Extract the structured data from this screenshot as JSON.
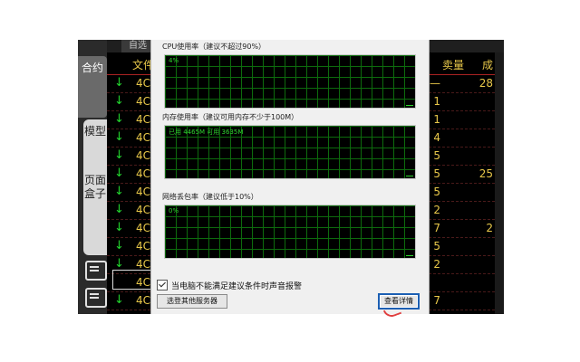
{
  "background_app": {
    "top_tab": "自选",
    "left_tabs": [
      "合约",
      "模型",
      "页面盒子"
    ],
    "headers": {
      "col1": "文件",
      "col_qty": "卖量",
      "col_last": "成"
    },
    "rows": [
      {
        "dir": "↓",
        "code": "4C",
        "qty": "—",
        "qty2": "28"
      },
      {
        "dir": "↓",
        "code": "4C",
        "qty": "1",
        "qty2": ""
      },
      {
        "dir": "↓",
        "code": "4C",
        "qty": "1",
        "qty2": ""
      },
      {
        "dir": "↓",
        "code": "4C",
        "qty": "4",
        "qty2": ""
      },
      {
        "dir": "↓",
        "code": "4C",
        "qty": "5",
        "qty2": ""
      },
      {
        "dir": "↓",
        "code": "4C",
        "qty": "5",
        "qty2": "25"
      },
      {
        "dir": "↓",
        "code": "4C",
        "qty": "5",
        "qty2": ""
      },
      {
        "dir": "↓",
        "code": "4C",
        "qty": "2",
        "qty2": ""
      },
      {
        "dir": "↓",
        "code": "4C",
        "qty": "7",
        "qty2": "2"
      },
      {
        "dir": "↓",
        "code": "4C",
        "qty": "5",
        "qty2": ""
      },
      {
        "dir": "↓",
        "code": "4C",
        "qty": "2",
        "qty2": ""
      },
      {
        "dir": "",
        "code": "4C",
        "qty": "",
        "qty2": ""
      },
      {
        "dir": "↓",
        "code": "4C",
        "qty": "7",
        "qty2": ""
      }
    ],
    "up_color": "#22d42e",
    "text_color": "#e8c84a"
  },
  "dialog": {
    "cpu": {
      "label": "CPU使用率（建议不超过90%）",
      "value": "4%"
    },
    "memory": {
      "label": "内存使用率（建议可用内存不少于100M）",
      "value": "已用 4465M 可用 3635M"
    },
    "network": {
      "label": "网络丢包率（建议低于10%）",
      "value": "0%"
    },
    "alarm_checkbox": {
      "label": "当电脑不能满足建议条件时声音报警",
      "checked": true
    },
    "buttons": {
      "select_server": "选登其他服务器",
      "view_details": "查看详情"
    },
    "graph_color": "#2fd42f"
  }
}
